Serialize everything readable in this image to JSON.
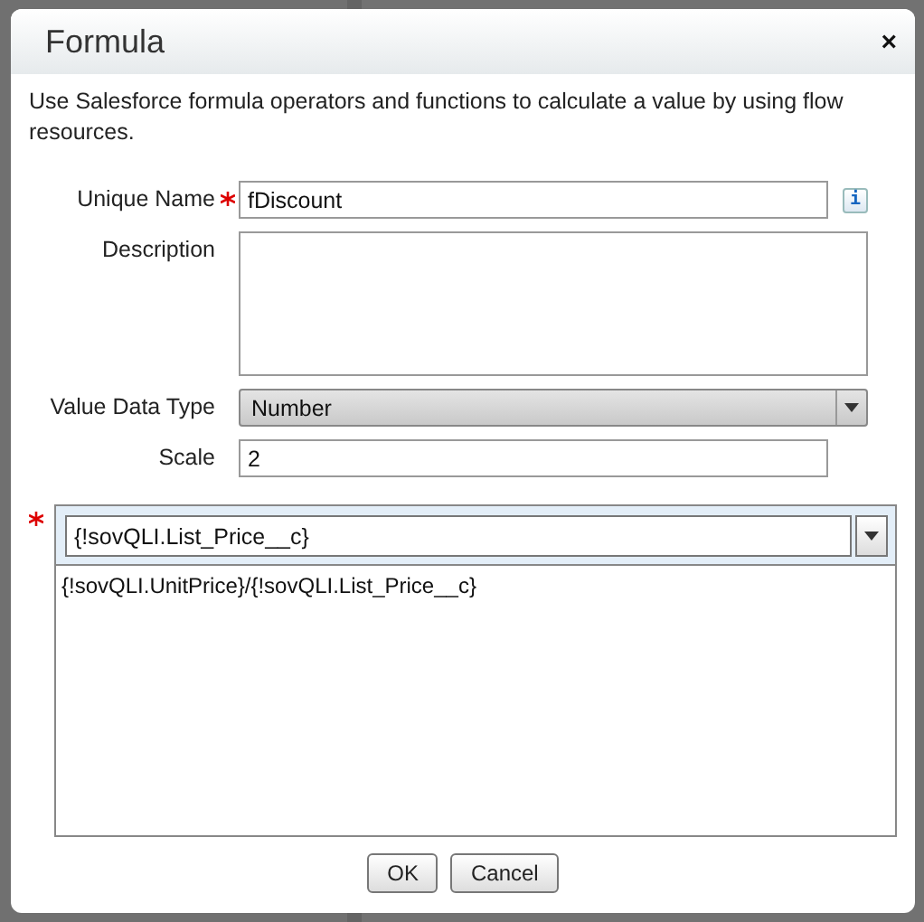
{
  "dialog": {
    "title": "Formula",
    "close": "×",
    "intro": "Use Salesforce formula operators and functions to calculate a value by using flow resources."
  },
  "fields": [
    {
      "kind": "text",
      "label": "Unique Name",
      "required": true,
      "value": "fDiscount",
      "info": "i"
    },
    {
      "kind": "textarea",
      "label": "Description",
      "required": false
    },
    {
      "kind": "select",
      "label": "Value Data Type",
      "required": false,
      "value": "Number"
    },
    {
      "kind": "text",
      "label": "Scale",
      "required": false,
      "value": "2"
    }
  ],
  "formula": {
    "required": true,
    "resource": "{!sovQLI.List_Price__c}",
    "expression": "{!sovQLI.UnitPrice}/{!sovQLI.List_Price__c}"
  },
  "buttons": [
    "OK",
    "Cancel"
  ]
}
